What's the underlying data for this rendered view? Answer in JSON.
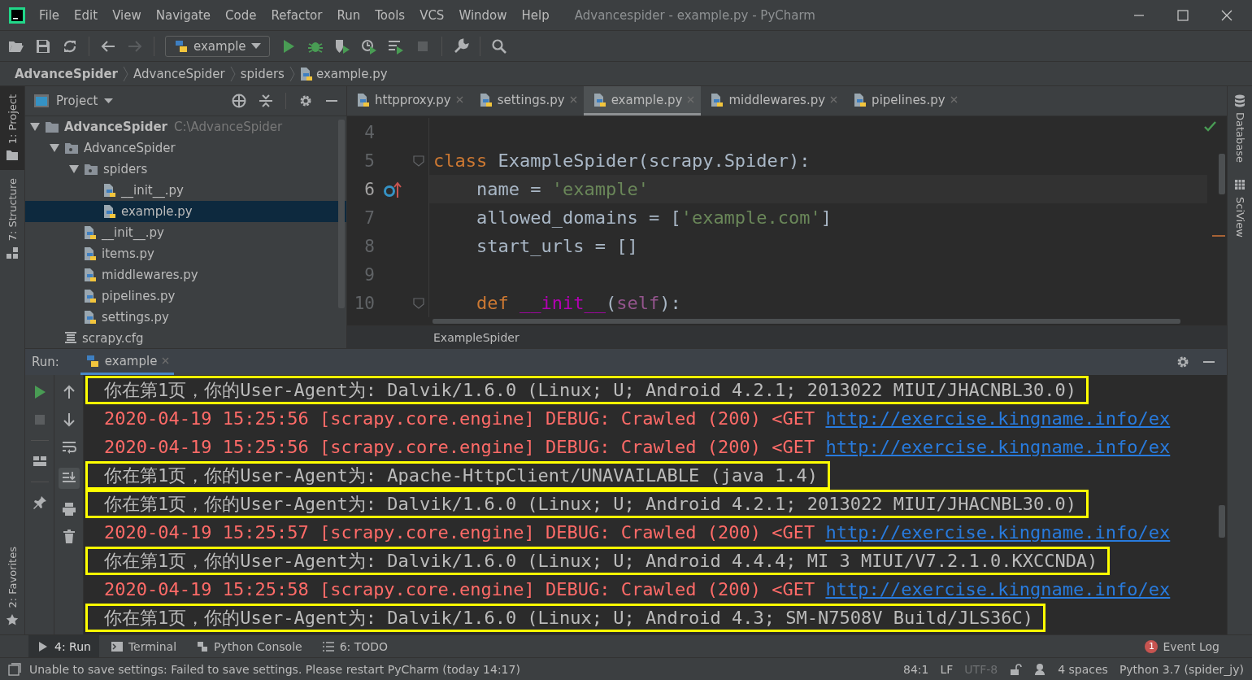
{
  "window": {
    "title": "Advancespider - example.py - PyCharm"
  },
  "menu": [
    "File",
    "Edit",
    "View",
    "Navigate",
    "Code",
    "Refactor",
    "Run",
    "Tools",
    "VCS",
    "Window",
    "Help"
  ],
  "toolbar": {
    "run_configuration": "example"
  },
  "breadcrumb": [
    {
      "label": "AdvanceSpider",
      "kind": "project"
    },
    {
      "label": "AdvanceSpider",
      "kind": "folder"
    },
    {
      "label": "spiders",
      "kind": "folder"
    },
    {
      "label": "example.py",
      "kind": "python"
    }
  ],
  "left_tool_windows_top": [
    {
      "label": "1: Project",
      "kind": "project",
      "selected": true
    },
    {
      "label": "7: Structure",
      "kind": "structure",
      "selected": false
    }
  ],
  "left_tool_windows_bottom": [
    {
      "label": "2: Favorites",
      "kind": "favorites",
      "selected": false
    }
  ],
  "project_panel": {
    "title": "Project",
    "tree": [
      {
        "label": "AdvanceSpider",
        "path": "C:\\AdvanceSpider",
        "kind": "folder",
        "expanded": true,
        "selected": false,
        "children": [
          {
            "label": "AdvanceSpider",
            "kind": "package",
            "expanded": true,
            "selected": false,
            "children": [
              {
                "label": "spiders",
                "kind": "package",
                "expanded": true,
                "selected": false,
                "children": [
                  {
                    "label": "__init__.py",
                    "kind": "python",
                    "selected": false
                  },
                  {
                    "label": "example.py",
                    "kind": "python",
                    "selected": true
                  }
                ]
              },
              {
                "label": "__init__.py",
                "kind": "python",
                "selected": false
              },
              {
                "label": "items.py",
                "kind": "python",
                "selected": false
              },
              {
                "label": "middlewares.py",
                "kind": "python",
                "selected": false
              },
              {
                "label": "pipelines.py",
                "kind": "python",
                "selected": false
              },
              {
                "label": "settings.py",
                "kind": "python",
                "selected": false
              }
            ]
          },
          {
            "label": "scrapy.cfg",
            "kind": "config",
            "selected": false
          }
        ]
      }
    ]
  },
  "editor": {
    "tabs": [
      {
        "label": "httpproxy.py",
        "selected": false
      },
      {
        "label": "settings.py",
        "selected": false
      },
      {
        "label": "example.py",
        "selected": true
      },
      {
        "label": "middlewares.py",
        "selected": false
      },
      {
        "label": "pipelines.py",
        "selected": false
      }
    ],
    "lines": [
      {
        "number": "4",
        "current": false,
        "fold": false,
        "marker": false
      },
      {
        "number": "5",
        "current": false,
        "fold": true,
        "marker": false,
        "tokens": [
          {
            "text": "class",
            "kind": "keyword"
          },
          {
            "text": " ExampleSpider(scrapy.Spider):",
            "kind": "plain"
          }
        ]
      },
      {
        "number": "6",
        "current": true,
        "fold": false,
        "marker": true,
        "tokens": [
          {
            "text": "    name = ",
            "kind": "plain"
          },
          {
            "text": "'example'",
            "kind": "string"
          }
        ]
      },
      {
        "number": "7",
        "current": false,
        "fold": false,
        "marker": false,
        "tokens": [
          {
            "text": "    allowed_domains = [",
            "kind": "plain"
          },
          {
            "text": "'example.com'",
            "kind": "string"
          },
          {
            "text": "]",
            "kind": "plain"
          }
        ]
      },
      {
        "number": "8",
        "current": false,
        "fold": false,
        "marker": false,
        "tokens": [
          {
            "text": "    start_urls = []",
            "kind": "plain"
          }
        ]
      },
      {
        "number": "9",
        "current": false,
        "fold": false,
        "marker": false
      },
      {
        "number": "10",
        "current": false,
        "fold": true,
        "marker": false,
        "tokens": [
          {
            "text": "    def",
            "kind": "keyword"
          },
          {
            "text": " __init__",
            "kind": "magic"
          },
          {
            "text": "(",
            "kind": "plain"
          },
          {
            "text": "self",
            "kind": "self"
          },
          {
            "text": "):",
            "kind": "plain"
          }
        ]
      }
    ],
    "breadcrumb": "ExampleSpider"
  },
  "right_tool_windows": [
    {
      "label": "Database",
      "kind": "database"
    },
    {
      "label": "SciView",
      "kind": "sciview"
    }
  ],
  "run_panel": {
    "label": "Run:",
    "tab": "example",
    "lines": [
      {
        "highlighted": true,
        "segments": [
          {
            "text": "你在第1页，你的User-Agent为: Dalvik/1.6.0 (Linux; U; Android 4.2.1; 2013022 MIUI/JHACNBL30.0)",
            "kind": "info"
          }
        ]
      },
      {
        "highlighted": false,
        "segments": [
          {
            "text": "2020-04-19 15:25:56 [scrapy.core.engine] DEBUG: Crawled (200) <GET ",
            "kind": "error"
          },
          {
            "text": "http://exercise.kingname.info/ex",
            "kind": "link"
          }
        ]
      },
      {
        "highlighted": false,
        "segments": [
          {
            "text": "2020-04-19 15:25:56 [scrapy.core.engine] DEBUG: Crawled (200) <GET ",
            "kind": "error"
          },
          {
            "text": "http://exercise.kingname.info/ex",
            "kind": "link"
          }
        ]
      },
      {
        "highlighted": true,
        "segments": [
          {
            "text": "你在第1页，你的User-Agent为: Apache-HttpClient/UNAVAILABLE (java 1.4)",
            "kind": "info"
          }
        ]
      },
      {
        "highlighted": true,
        "segments": [
          {
            "text": "你在第1页，你的User-Agent为: Dalvik/1.6.0 (Linux; U; Android 4.2.1; 2013022 MIUI/JHACNBL30.0)",
            "kind": "info"
          }
        ]
      },
      {
        "highlighted": false,
        "segments": [
          {
            "text": "2020-04-19 15:25:57 [scrapy.core.engine] DEBUG: Crawled (200) <GET ",
            "kind": "error"
          },
          {
            "text": "http://exercise.kingname.info/ex",
            "kind": "link"
          }
        ]
      },
      {
        "highlighted": true,
        "segments": [
          {
            "text": "你在第1页，你的User-Agent为: Dalvik/1.6.0 (Linux; U; Android 4.4.4; MI 3 MIUI/V7.2.1.0.KXCCNDA)",
            "kind": "info"
          }
        ]
      },
      {
        "highlighted": false,
        "segments": [
          {
            "text": "2020-04-19 15:25:58 [scrapy.core.engine] DEBUG: Crawled (200) <GET ",
            "kind": "error"
          },
          {
            "text": "http://exercise.kingname.info/ex",
            "kind": "link"
          }
        ]
      },
      {
        "highlighted": true,
        "segments": [
          {
            "text": "你在第1页，你的User-Agent为: Dalvik/1.6.0 (Linux; U; Android 4.3; SM-N7508V Build/JLS36C)",
            "kind": "info"
          }
        ]
      }
    ]
  },
  "bottom_tool_windows": [
    {
      "label": "4: Run",
      "kind": "run",
      "selected": true
    },
    {
      "label": "Terminal",
      "kind": "terminal",
      "selected": false
    },
    {
      "label": "Python Console",
      "kind": "console",
      "selected": false
    },
    {
      "label": "6: TODO",
      "kind": "todo",
      "selected": false
    }
  ],
  "event_log": {
    "label": "Event Log",
    "count": "1"
  },
  "status_bar": {
    "message": "Unable to save settings: Failed to save settings. Please restart PyCharm (today 14:17)",
    "position": "84:1",
    "line_separator": "LF",
    "encoding": "UTF-8",
    "indent": "4 spaces",
    "interpreter": "Python 3.7 (spider_jy)"
  }
}
